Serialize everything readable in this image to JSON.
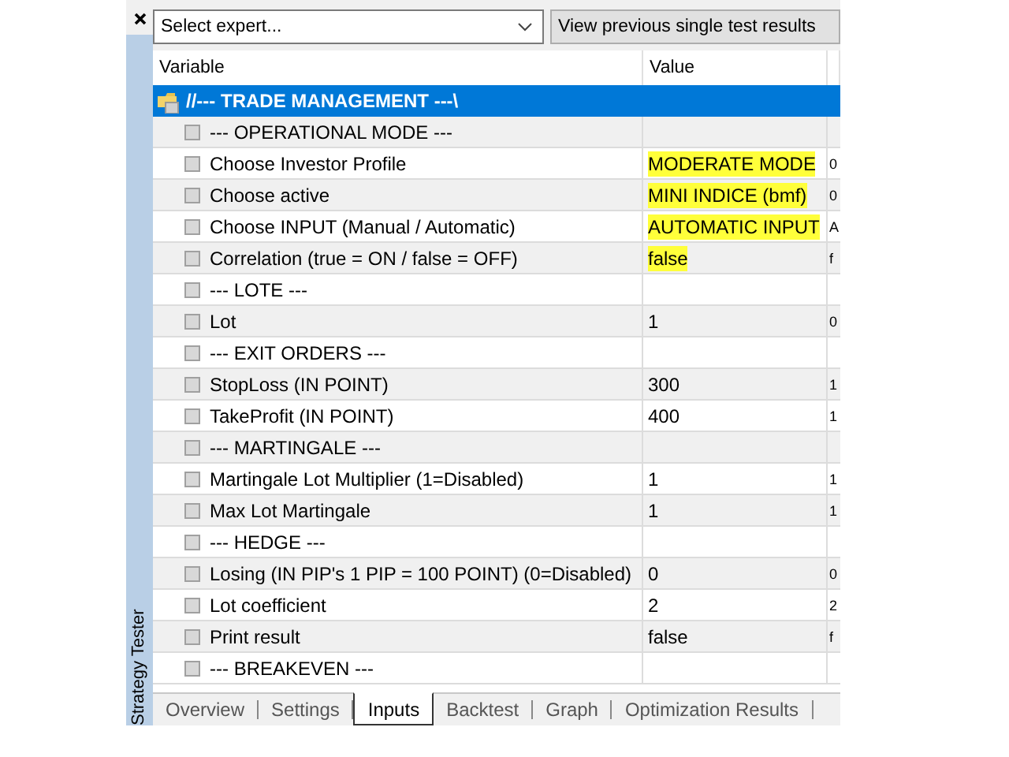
{
  "panel": {
    "title": "Strategy Tester"
  },
  "toolbar": {
    "expert_select": {
      "value": "Select expert..."
    },
    "button": "View previous single test results"
  },
  "table": {
    "columns": [
      "Variable",
      "Value"
    ],
    "group": {
      "label": "//--- TRADE MANAGEMENT ---\\",
      "selected": true
    },
    "rows": [
      {
        "kind": "section",
        "variable": "--- OPERATIONAL MODE ---",
        "checked": false
      },
      {
        "kind": "param",
        "variable": "Choose Investor Profile",
        "value": "MODERATE MODE",
        "highlighted": true,
        "column_3": "0",
        "checked": false
      },
      {
        "kind": "param",
        "variable": "Choose active",
        "value": "MINI INDICE (bmf)",
        "highlighted": true,
        "column_3": "0",
        "checked": false
      },
      {
        "kind": "param",
        "variable": "Choose INPUT (Manual / Automatic)",
        "value": "AUTOMATIC INPUT",
        "highlighted": true,
        "column_3": "A",
        "checked": false
      },
      {
        "kind": "param",
        "variable": "Correlation (true = ON / false = OFF)",
        "value": "false",
        "highlighted": true,
        "column_3": "f",
        "checked": false
      },
      {
        "kind": "section",
        "variable": "--- LOTE ---",
        "checked": false
      },
      {
        "kind": "param",
        "variable": "Lot",
        "value": "1",
        "highlighted": false,
        "column_3": "0",
        "checked": false
      },
      {
        "kind": "section",
        "variable": "--- EXIT ORDERS ---",
        "checked": false
      },
      {
        "kind": "param",
        "variable": "StopLoss (IN POINT)",
        "value": "300",
        "highlighted": false,
        "column_3": "1",
        "checked": false
      },
      {
        "kind": "param",
        "variable": "TakeProfit (IN POINT)",
        "value": "400",
        "highlighted": false,
        "column_3": "1",
        "checked": false
      },
      {
        "kind": "section",
        "variable": "--- MARTINGALE ---",
        "checked": false
      },
      {
        "kind": "param",
        "variable": "Martingale Lot Multiplier (1=Disabled)",
        "value": "1",
        "highlighted": false,
        "column_3": "1",
        "checked": false
      },
      {
        "kind": "param",
        "variable": "Max Lot Martingale",
        "value": "1",
        "highlighted": false,
        "column_3": "1",
        "checked": false
      },
      {
        "kind": "section",
        "variable": "--- HEDGE ---",
        "checked": false
      },
      {
        "kind": "param",
        "variable": "Losing (IN PIP's 1 PIP = 100 POINT) (0=Disabled)",
        "value": "0",
        "highlighted": false,
        "column_3": "0",
        "checked": false
      },
      {
        "kind": "param",
        "variable": "Lot coefficient",
        "value": "2",
        "highlighted": false,
        "column_3": "2",
        "checked": false
      },
      {
        "kind": "param",
        "variable": "Print result",
        "value": "false",
        "highlighted": false,
        "column_3": "f",
        "checked": false
      },
      {
        "kind": "section",
        "variable": "--- BREAKEVEN ---",
        "checked": false
      }
    ]
  },
  "tabs": [
    {
      "label": "Overview",
      "selected": false
    },
    {
      "label": "Settings",
      "selected": false
    },
    {
      "label": "Inputs",
      "selected": true
    },
    {
      "label": "Backtest",
      "selected": false
    },
    {
      "label": "Graph",
      "selected": false
    },
    {
      "label": "Optimization Results",
      "selected": false
    }
  ]
}
